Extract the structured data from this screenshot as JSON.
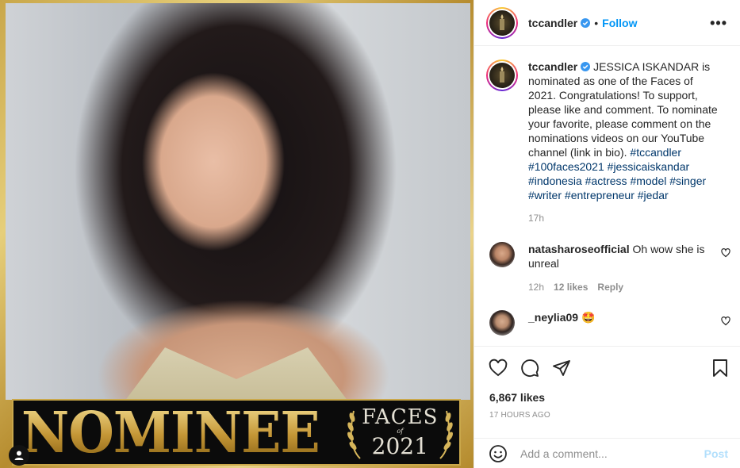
{
  "media": {
    "banner_main": "NOMINEE",
    "banner_faces": "FACES",
    "banner_of": "of",
    "banner_year": "2021"
  },
  "header": {
    "username": "tccandler",
    "separator": "•",
    "follow_label": "Follow",
    "more_label": "•••"
  },
  "caption": {
    "username": "tccandler",
    "text": "JESSICA ISKANDAR is nominated as one of the Faces of 2021. Congratulations!  To support, please like and comment.  To nominate your favorite,  please comment on the nominations videos on our YouTube channel (link in bio).",
    "hashtags": [
      "#tccandler",
      "#100faces2021",
      "#jessicaiskandar",
      "#indonesia",
      "#actress",
      "#model",
      "#singer",
      "#writer",
      "#entrepreneur",
      "#jedar"
    ],
    "time": "17h"
  },
  "comments": [
    {
      "username": "natasharoseofficial",
      "text": "Oh wow she is unreal",
      "time": "12h",
      "likes": "12 likes",
      "reply": "Reply"
    },
    {
      "username": "_neylia09",
      "text": "🤩"
    }
  ],
  "actions": {
    "likes": "6,867 likes",
    "time_ago": "17 HOURS AGO"
  },
  "add_comment": {
    "placeholder": "Add a comment...",
    "post_label": "Post"
  },
  "colors": {
    "accent": "#0095f6",
    "hashtag": "#00376b",
    "muted": "#8e8e8e"
  }
}
